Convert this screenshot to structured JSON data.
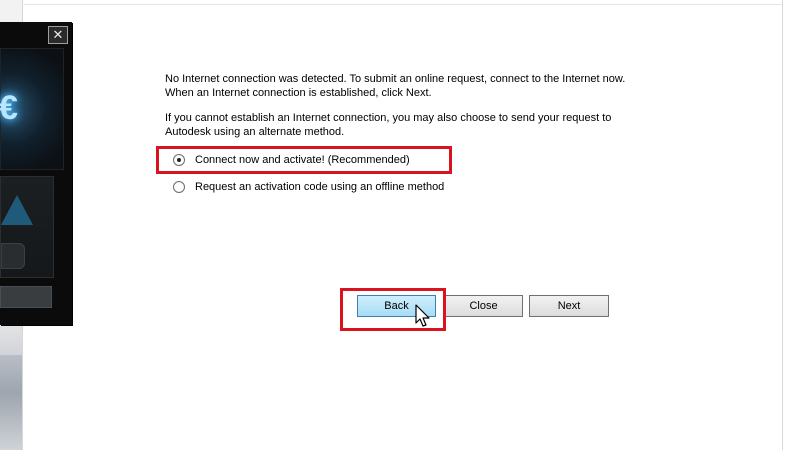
{
  "content": {
    "para1_line1": "No Internet connection was detected. To submit an online request, connect to the Internet now.",
    "para1_line2": "When an Internet connection is established, click Next.",
    "para2_line1": "If you cannot establish an Internet connection, you may also choose to send your request to",
    "para2_line2": "Autodesk using an alternate method."
  },
  "options": [
    {
      "label": "Connect now and activate! (Recommended)",
      "selected": true
    },
    {
      "label": "Request an activation code using an offline method",
      "selected": false
    }
  ],
  "buttons": {
    "back": "Back",
    "close": "Close",
    "next": "Next"
  },
  "splash": {
    "close_glyph": "✕",
    "logo_glyph": "€"
  },
  "colors": {
    "highlight": "#d9141e",
    "back_button_hover": "#a7dcf6"
  },
  "icons": {
    "cursor": "arrow-cursor-icon",
    "close": "close-icon"
  }
}
